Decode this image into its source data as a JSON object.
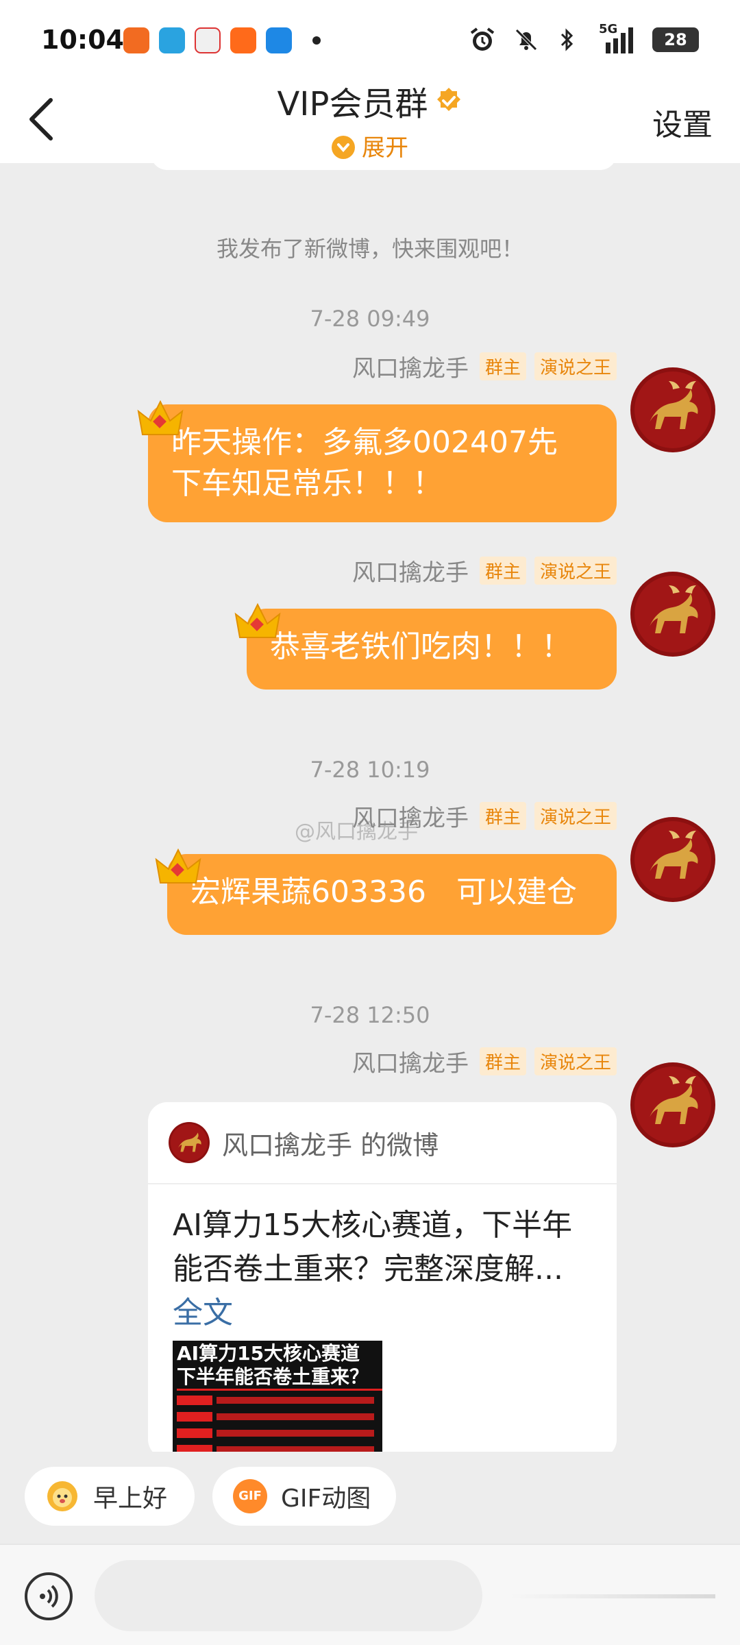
{
  "status_bar": {
    "time": "10:04",
    "network": "5G",
    "battery": "28"
  },
  "header": {
    "title": "VIP会员群",
    "expand_label": "展开",
    "settings_label": "设置"
  },
  "chat": {
    "system_message": "我发布了新微博，快来围观吧！",
    "watermark": "@风口擒龙手",
    "messages": [
      {
        "timestamp": "7-28 09:49",
        "sender": "风口擒龙手",
        "tag_owner": "群主",
        "tag_title": "演说之王",
        "text_line1": "昨天操作：多氟多002407先",
        "text_line2": "下车知足常乐！！！"
      },
      {
        "timestamp": "",
        "sender": "风口擒龙手",
        "tag_owner": "群主",
        "tag_title": "演说之王",
        "text_line1": "恭喜老铁们吃肉！！！"
      },
      {
        "timestamp": "7-28 10:19",
        "sender": "风口擒龙手",
        "tag_owner": "群主",
        "tag_title": "演说之王",
        "text_line1": "宏辉果蔬603336　可以建仓"
      },
      {
        "timestamp": "7-28 12:50",
        "sender": "风口擒龙手",
        "tag_owner": "群主",
        "tag_title": "演说之王"
      }
    ],
    "weibo_card": {
      "header": "风口擒龙手 的微博",
      "text_line1": "AI算力15大核心赛道，下半年",
      "text_line2": "能否卷土重来？完整深度解...",
      "link": "全文",
      "thumb_title_line1": "AI算力15大核心赛道",
      "thumb_title_line2": "下半年能否卷土重来？"
    }
  },
  "quick_replies": [
    {
      "label": "早上好",
      "icon": "sun-face-icon"
    },
    {
      "label": "GIF动图",
      "icon": "gif-icon",
      "icon_text": "GIF"
    }
  ],
  "colors": {
    "accent": "#ffa234",
    "tag_text": "#e8860c",
    "tag_bg": "#fdebd0",
    "link": "#3a6ea5"
  }
}
